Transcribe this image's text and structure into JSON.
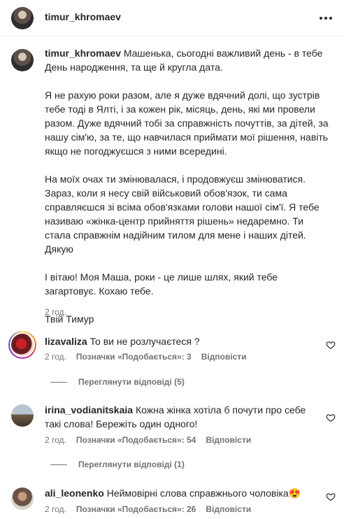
{
  "header": {
    "username": "timur_khromaev"
  },
  "caption": {
    "username": "timur_khromaev",
    "first_line": "Машенька, сьогодні важливий день - в тебе День народження, та ще й кругла дата.",
    "paragraphs": [
      "Я не рахую роки разом, але я дуже вдячний долі, що зустрів тебе тоді в Ялті, і за кожен рік, місяць, день, які ми провели разом. Дуже вдячний тобі за справжність почуттів, за дітей, за нашу сім'ю, за те, що навчилася приймати мої рішення, навіть якщо не погоджуєшся з ними всередині.",
      "На моїх очах ти змінювалася, і продовжуєш змінюватися. Зараз, коли я несу свій військовий обов'язок, ти сама справляєшся зі всіма обов'язками голови нашої сім'ї. Я тебе називаю «жінка-центр прийняття рішень» недаремно. Ти стала справжнім надійним тилом для мене і наших дітей. Дякую",
      "І вітаю! Моя Маша, роки - це лише шлях, який тебе загартовує. Кохаю тебе.",
      "Твій Тимур"
    ],
    "time": "2 год."
  },
  "comments": [
    {
      "username": "lizavaliza",
      "text": "То ви не розлучаєтеся ?",
      "time": "2 год.",
      "likes": "Позначки «Подобається»: 3",
      "reply": "Відповісти",
      "view_replies": "Переглянути відповіді (5)"
    },
    {
      "username": "irina_vodianitskaia",
      "text": "Кожна жінка хотіла б почути про себе такі слова! Бережіть один одного!",
      "time": "2 год.",
      "likes": "Позначки «Подобається»: 54",
      "reply": "Відповісти",
      "view_replies": "Переглянути відповіді (1)"
    },
    {
      "username": "ali_leonenko",
      "text": "Неймовірні слова справжнього чоловіка",
      "emoji": "😍",
      "time": "2 год.",
      "likes": "Позначки «Подобається»: 26",
      "reply": "Відповісти"
    }
  ]
}
